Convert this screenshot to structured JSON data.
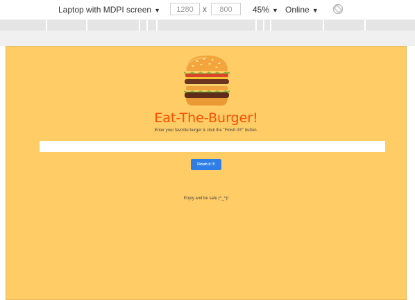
{
  "devtools": {
    "device": "Laptop with MDPI screen",
    "width": "1280",
    "height": "800",
    "dimension_separator": "x",
    "zoom": "45%",
    "network": "Online",
    "rotate_icon": "rotate-icon"
  },
  "page": {
    "title": "Eat-The-Burger!",
    "subtitle": "Enter your favorite burger & click the \"Finish it!!!\" button.",
    "input_value": "",
    "button_label": "Finish it !!!",
    "footer": "Enjoy and be safe (^_^)/",
    "logo_icon": "burger-icon",
    "background_color": "#ffcc66",
    "title_color": "#ff4e00",
    "button_color": "#2f7ee8"
  }
}
